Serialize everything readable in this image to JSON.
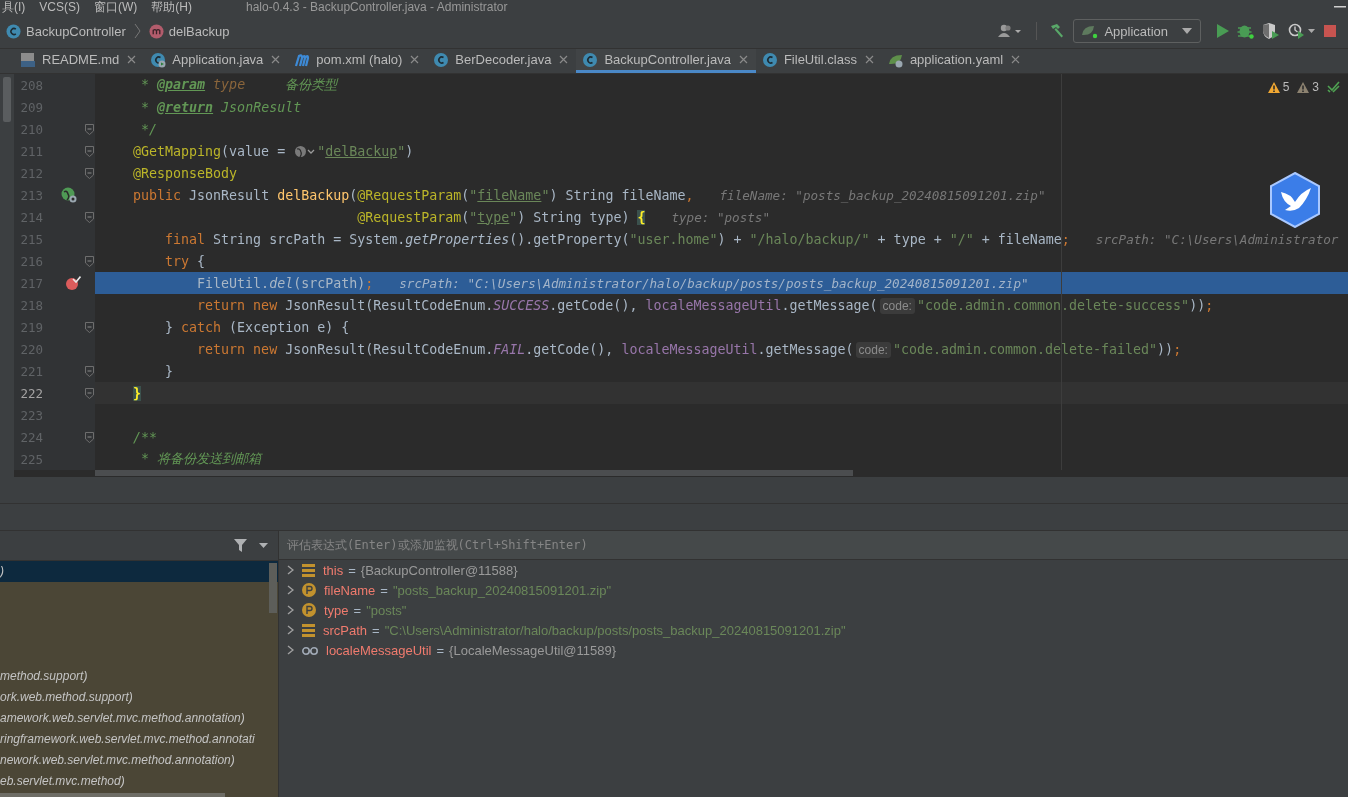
{
  "title_bar": {
    "menus": [
      {
        "label": "具(I)"
      },
      {
        "label": "VCS(S)"
      },
      {
        "label": "窗口(W)"
      },
      {
        "label": "帮助(H)"
      }
    ],
    "title": "halo-0.4.3 - BackupController.java - Administrator"
  },
  "breadcrumb": [
    {
      "kind": "class",
      "label": "BackupController"
    },
    {
      "kind": "method",
      "label": "delBackup"
    }
  ],
  "run_config": {
    "label": "Application"
  },
  "tabs": [
    {
      "kind": "markdown",
      "label": "README.md",
      "selected": false
    },
    {
      "kind": "run-class",
      "label": "Application.java",
      "selected": false
    },
    {
      "kind": "maven",
      "label": "pom.xml (halo)",
      "selected": false
    },
    {
      "kind": "class",
      "label": "BerDecoder.java",
      "selected": false
    },
    {
      "kind": "class",
      "label": "BackupController.java",
      "selected": true
    },
    {
      "kind": "class",
      "label": "FileUtil.class",
      "selected": false
    },
    {
      "kind": "yaml",
      "label": "application.yaml",
      "selected": false
    }
  ],
  "editor": {
    "warnings": "5",
    "weak_warnings": "3",
    "lines": [
      {
        "number": "208",
        "fold": false,
        "endpoint": false,
        "breakpoint": false,
        "execution": false,
        "caret": false,
        "tokens": [
          {
            "kind": "doc",
            "text": "     * "
          },
          {
            "kind": "doctag",
            "text": "@param"
          },
          {
            "kind": "docparam",
            "text": " type"
          },
          {
            "kind": "doc",
            "text": "     备份类型"
          }
        ]
      },
      {
        "number": "209",
        "fold": false,
        "endpoint": false,
        "breakpoint": false,
        "execution": false,
        "caret": false,
        "tokens": [
          {
            "kind": "doc",
            "text": "     * "
          },
          {
            "kind": "doctag",
            "text": "@return"
          },
          {
            "kind": "doc",
            "text": " JsonResult"
          }
        ]
      },
      {
        "number": "210",
        "fold": true,
        "endpoint": false,
        "breakpoint": false,
        "execution": false,
        "caret": false,
        "tokens": [
          {
            "kind": "doc",
            "text": "     */"
          }
        ]
      },
      {
        "number": "211",
        "fold": true,
        "endpoint": false,
        "breakpoint": false,
        "execution": false,
        "caret": false,
        "tokens": [
          {
            "kind": "ann",
            "text": "    @GetMapping"
          },
          {
            "kind": "plain",
            "text": "(value = "
          },
          {
            "kind": "globe"
          },
          {
            "kind": "str",
            "text": "\""
          },
          {
            "kind": "strlink",
            "text": "delBackup"
          },
          {
            "kind": "str",
            "text": "\""
          },
          {
            "kind": "plain",
            "text": ")"
          }
        ]
      },
      {
        "number": "212",
        "fold": true,
        "endpoint": false,
        "breakpoint": false,
        "execution": false,
        "caret": false,
        "tokens": [
          {
            "kind": "ann",
            "text": "    @ResponseBody"
          }
        ]
      },
      {
        "number": "213",
        "fold": false,
        "endpoint": true,
        "breakpoint": false,
        "execution": false,
        "caret": false,
        "tokens": [
          {
            "kind": "kw",
            "text": "    public "
          },
          {
            "kind": "plain",
            "text": "JsonResult "
          },
          {
            "kind": "fn",
            "text": "delBackup"
          },
          {
            "kind": "plain",
            "text": "("
          },
          {
            "kind": "ann",
            "text": "@RequestParam"
          },
          {
            "kind": "plain",
            "text": "("
          },
          {
            "kind": "str",
            "text": "\""
          },
          {
            "kind": "strlink",
            "text": "fileName"
          },
          {
            "kind": "str",
            "text": "\""
          },
          {
            "kind": "plain",
            "text": ") String fileName"
          },
          {
            "kind": "kw",
            "text": ","
          },
          {
            "kind": "value",
            "text": "fileName: \"posts_backup_20240815091201.zip\""
          }
        ]
      },
      {
        "number": "214",
        "fold": true,
        "endpoint": false,
        "breakpoint": false,
        "execution": false,
        "caret": false,
        "tokens": [
          {
            "kind": "ann",
            "text": "                                @RequestParam"
          },
          {
            "kind": "plain",
            "text": "("
          },
          {
            "kind": "str",
            "text": "\""
          },
          {
            "kind": "strlink",
            "text": "type"
          },
          {
            "kind": "str",
            "text": "\""
          },
          {
            "kind": "plain",
            "text": ") String type) "
          },
          {
            "kind": "brace",
            "text": "{"
          },
          {
            "kind": "value",
            "text": "type: \"posts\""
          }
        ]
      },
      {
        "number": "215",
        "fold": false,
        "endpoint": false,
        "breakpoint": false,
        "execution": false,
        "caret": false,
        "tokens": [
          {
            "kind": "kw",
            "text": "        final "
          },
          {
            "kind": "plain",
            "text": "String srcPath = System."
          },
          {
            "kind": "italic",
            "text": "getProperties"
          },
          {
            "kind": "plain",
            "text": "().getProperty("
          },
          {
            "kind": "str",
            "text": "\"user.home\""
          },
          {
            "kind": "plain",
            "text": ") + "
          },
          {
            "kind": "str",
            "text": "\"/halo/backup/\""
          },
          {
            "kind": "plain",
            "text": " + type + "
          },
          {
            "kind": "str",
            "text": "\"/\""
          },
          {
            "kind": "plain",
            "text": " + fileName"
          },
          {
            "kind": "kw",
            "text": ";"
          },
          {
            "kind": "value",
            "text": "srcPath: \"C:\\Users\\Administrator"
          }
        ]
      },
      {
        "number": "216",
        "fold": true,
        "endpoint": false,
        "breakpoint": false,
        "execution": false,
        "caret": false,
        "tokens": [
          {
            "kind": "kw",
            "text": "        try "
          },
          {
            "kind": "plain",
            "text": "{"
          }
        ]
      },
      {
        "number": "217",
        "fold": false,
        "endpoint": false,
        "breakpoint": true,
        "execution": true,
        "caret": false,
        "tokens": [
          {
            "kind": "plain",
            "text": "            FileUtil."
          },
          {
            "kind": "italic",
            "text": "del"
          },
          {
            "kind": "plain",
            "text": "(srcPath)"
          },
          {
            "kind": "kw",
            "text": ";"
          },
          {
            "kind": "value",
            "text": "srcPath: \"C:\\Users\\Administrator/halo/backup/posts/posts_backup_20240815091201.zip\""
          }
        ]
      },
      {
        "number": "218",
        "fold": false,
        "endpoint": false,
        "breakpoint": false,
        "execution": false,
        "caret": false,
        "tokens": [
          {
            "kind": "kw",
            "text": "            return new "
          },
          {
            "kind": "plain",
            "text": "JsonResult(ResultCodeEnum."
          },
          {
            "kind": "static",
            "text": "SUCCESS"
          },
          {
            "kind": "plain",
            "text": ".getCode(), "
          },
          {
            "kind": "field",
            "text": "localeMessageUtil"
          },
          {
            "kind": "plain",
            "text": ".getMessage("
          },
          {
            "kind": "param_hint",
            "text": "code:"
          },
          {
            "kind": "str",
            "text": "\"code.admin.common.delete-success\""
          },
          {
            "kind": "plain",
            "text": "))"
          },
          {
            "kind": "kw",
            "text": ";"
          }
        ]
      },
      {
        "number": "219",
        "fold": true,
        "endpoint": false,
        "breakpoint": false,
        "execution": false,
        "caret": false,
        "tokens": [
          {
            "kind": "plain",
            "text": "        } "
          },
          {
            "kind": "kw",
            "text": "catch "
          },
          {
            "kind": "plain",
            "text": "(Exception e) {"
          }
        ]
      },
      {
        "number": "220",
        "fold": false,
        "endpoint": false,
        "breakpoint": false,
        "execution": false,
        "caret": false,
        "tokens": [
          {
            "kind": "kw",
            "text": "            return new "
          },
          {
            "kind": "plain",
            "text": "JsonResult(ResultCodeEnum."
          },
          {
            "kind": "static",
            "text": "FAIL"
          },
          {
            "kind": "plain",
            "text": ".getCode(), "
          },
          {
            "kind": "field",
            "text": "localeMessageUtil"
          },
          {
            "kind": "plain",
            "text": ".getMessage("
          },
          {
            "kind": "param_hint",
            "text": "code:"
          },
          {
            "kind": "str",
            "text": "\"code.admin.common.delete-failed\""
          },
          {
            "kind": "plain",
            "text": "))"
          },
          {
            "kind": "kw",
            "text": ";"
          }
        ]
      },
      {
        "number": "221",
        "fold": true,
        "endpoint": false,
        "breakpoint": false,
        "execution": false,
        "caret": false,
        "tokens": [
          {
            "kind": "plain",
            "text": "        }"
          }
        ]
      },
      {
        "number": "222",
        "fold": true,
        "endpoint": false,
        "breakpoint": false,
        "execution": false,
        "caret": true,
        "tokens": [
          {
            "kind": "brace",
            "text": "    }"
          }
        ]
      },
      {
        "number": "223",
        "fold": false,
        "endpoint": false,
        "breakpoint": false,
        "execution": false,
        "caret": false
      },
      {
        "number": "224",
        "fold": true,
        "endpoint": false,
        "breakpoint": false,
        "execution": false,
        "caret": false,
        "tokens": [
          {
            "kind": "doc",
            "text": "    /**"
          }
        ]
      },
      {
        "number": "225",
        "fold": false,
        "endpoint": false,
        "breakpoint": false,
        "execution": false,
        "caret": false,
        "tokens": [
          {
            "kind": "doc",
            "text": "     * 将备份发送到邮箱"
          }
        ]
      }
    ]
  },
  "frames": [
    {
      "text": ")",
      "selected": true
    },
    {
      "text": "method.support)",
      "selected": false
    },
    {
      "text": "ork.web.method.support)",
      "selected": false
    },
    {
      "text": "amework.web.servlet.mvc.method.annotation)",
      "selected": false
    },
    {
      "text": "ringframework.web.servlet.mvc.method.annotati",
      "selected": false
    },
    {
      "text": "nework.web.servlet.mvc.method.annotation)",
      "selected": false
    },
    {
      "text": "eb.servlet.mvc.method)",
      "selected": false
    }
  ],
  "evaluate": {
    "placeholder": "评估表达式(Enter)或添加监视(Ctrl+Shift+Enter)"
  },
  "variables": [
    {
      "kind": "field",
      "name": "this",
      "operator": "=",
      "value": "{BackupController@11588}",
      "string_value": false
    },
    {
      "kind": "param",
      "name": "fileName",
      "operator": "=",
      "value": "\"posts_backup_20240815091201.zip\"",
      "string_value": true
    },
    {
      "kind": "param",
      "name": "type",
      "operator": "=",
      "value": "\"posts\"",
      "string_value": true
    },
    {
      "kind": "field",
      "name": "srcPath",
      "operator": "=",
      "value": "\"C:\\Users\\Administrator/halo/backup/posts/posts_backup_20240815091201.zip\"",
      "string_value": true
    },
    {
      "kind": "watch",
      "name": "localeMessageUtil",
      "operator": "=",
      "value": "{LocaleMessageUtil@11589}",
      "string_value": false
    }
  ]
}
